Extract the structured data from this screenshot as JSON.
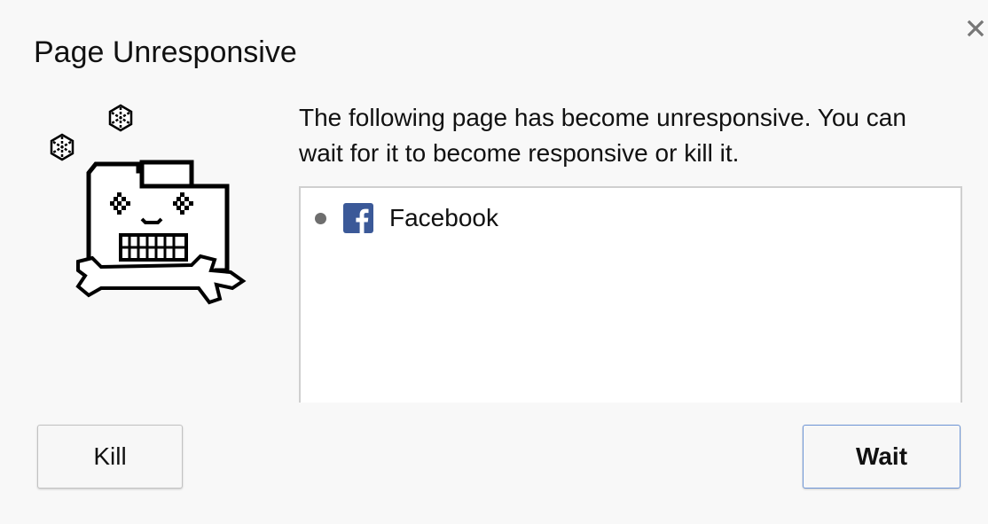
{
  "dialog": {
    "title": "Page Unresponsive",
    "message": "The following page has become unresponsive. You can wait for it to become responsive or kill it.",
    "close_icon": "close-icon",
    "illustration": "unresponsive-page-mascot"
  },
  "pages": [
    {
      "label": "Facebook",
      "icon": "facebook-favicon",
      "icon_color": "#3b5998"
    }
  ],
  "buttons": {
    "kill_label": "Kill",
    "wait_label": "Wait"
  },
  "colors": {
    "background": "#f8f8f8",
    "default_button_border": "#6d95d6",
    "list_border": "#cfcfcf"
  }
}
